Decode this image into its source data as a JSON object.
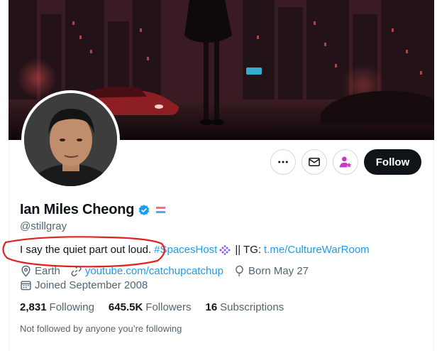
{
  "profile": {
    "display_name": "Ian Miles Cheong",
    "handle": "@stillgray",
    "bio": {
      "text": "I say the quiet part out loud.",
      "hashtag": "#SpacesHost",
      "separator": "|| TG:",
      "link": "t.me/CultureWarRoom"
    },
    "location": "Earth",
    "website": "youtube.com/catchupcatchup",
    "birthday": "Born May 27",
    "joined": "Joined September 2008",
    "following_count": "2,831",
    "following_label": "Following",
    "followers_count": "645.5K",
    "followers_label": "Followers",
    "subscriptions_count": "16",
    "subscriptions_label": "Subscriptions",
    "followed_by_text": "Not followed by anyone you’re following"
  },
  "actions": {
    "follow_label": "Follow",
    "more_icon": "more-icon",
    "message_icon": "envelope-icon",
    "subscribe_icon": "subscribe-person-star-icon"
  },
  "colors": {
    "accent": "#1d9bf0",
    "verified": "#1d9bf0",
    "subscribe": "#c936cc",
    "annotation": "#e0211f",
    "primary_text": "#0f1419",
    "secondary_text": "#536471"
  }
}
